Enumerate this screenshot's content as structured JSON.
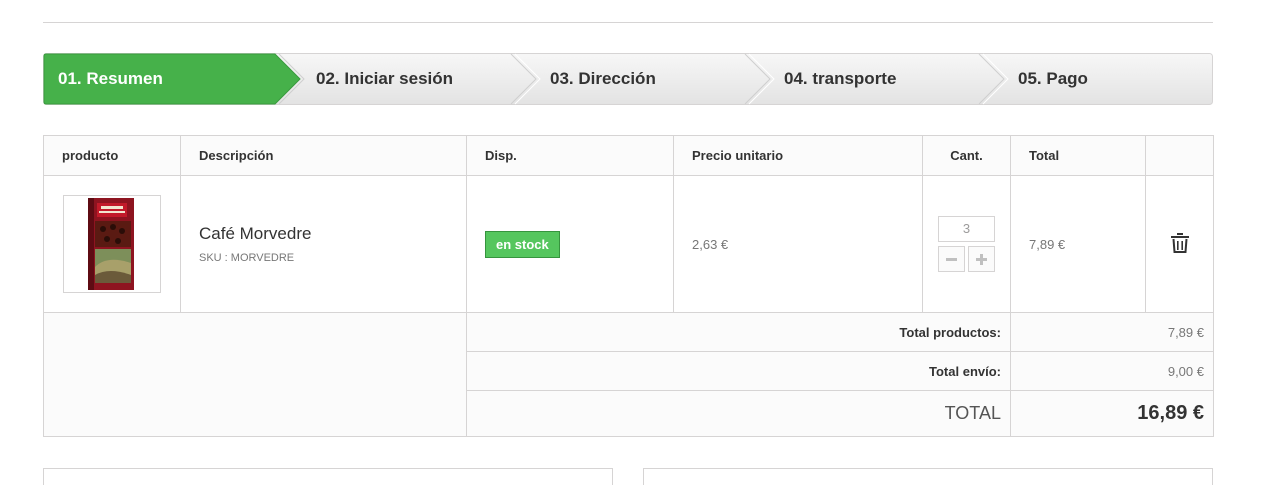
{
  "steps": [
    {
      "label": "01. Resumen",
      "active": true
    },
    {
      "label": "02. Iniciar sesión",
      "active": false
    },
    {
      "label": "03. Dirección",
      "active": false
    },
    {
      "label": "04. transporte",
      "active": false
    },
    {
      "label": "05. Pago",
      "active": false
    }
  ],
  "colors": {
    "active_step": "#46b14a",
    "inactive_step": "#f0f0f0",
    "stock_badge": "#55c65e",
    "border": "#d6d4d4"
  },
  "cart": {
    "headers": {
      "product": "producto",
      "description": "Descripción",
      "availability": "Disp.",
      "unit_price": "Precio unitario",
      "quantity": "Cant.",
      "total": "Total"
    },
    "item": {
      "image_icon": "coffee-package-image",
      "name": "Café Morvedre",
      "sku": "SKU : MORVEDRE",
      "availability": "en stock",
      "unit_price": "2,63 €",
      "quantity": "3",
      "total": "7,89 €",
      "delete_icon": "trash-icon",
      "minus_icon": "minus-icon",
      "plus_icon": "plus-icon"
    },
    "summary": {
      "products_label": "Total productos:",
      "products_value": "7,89 €",
      "shipping_label": "Total envío:",
      "shipping_value": "9,00 €",
      "total_label": "TOTAL",
      "total_value": "16,89 €"
    }
  }
}
